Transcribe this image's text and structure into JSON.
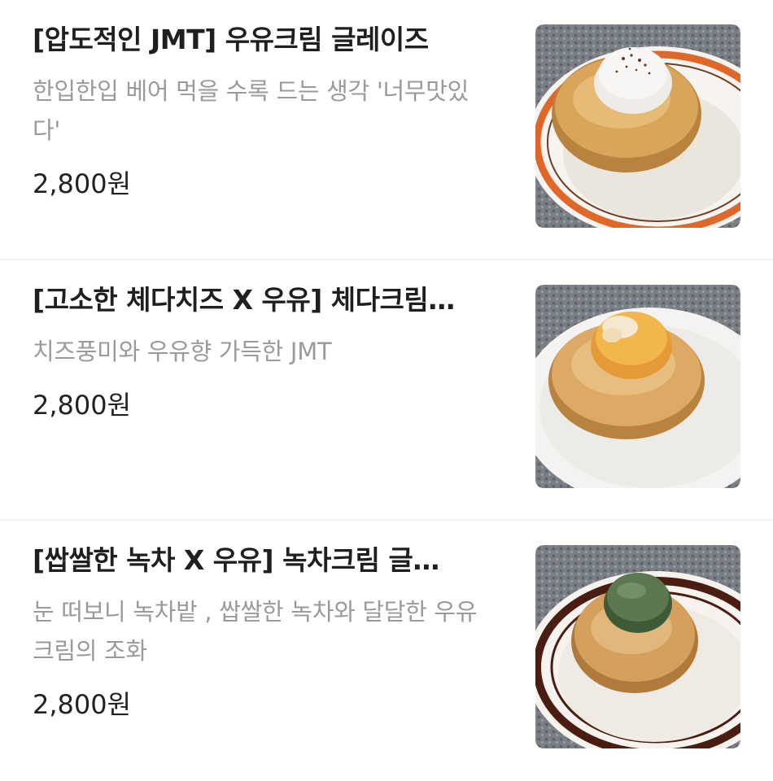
{
  "menu": {
    "items": [
      {
        "title": "[압도적인 JMT] 우유크림 글레이즈",
        "description": "한입한입 베어 먹을 수록 드는 생각 '너무맛있다'",
        "price": "2,800원",
        "image": {
          "plate_rim_color": "#e0672a",
          "cream_color": "#f2f0ee",
          "topping": "cocoa-powder"
        }
      },
      {
        "title": "[고소한 체다치즈 X 우유] 체다크림…",
        "description": "치즈풍미와 우유향 가득한 JMT",
        "price": "2,800원",
        "image": {
          "plate_rim_color": "#f4f3f1",
          "cream_color": "#f0b54a",
          "topping": "cheddar-cream"
        }
      },
      {
        "title": "[쌉쌀한 녹차 X 우유] 녹차크림 글…",
        "description": "눈 떠보니 녹차밭 , 쌉쌀한 녹차와 달달한 우유크림의 조화",
        "price": "2,800원",
        "image": {
          "plate_rim_color": "#4a1d12",
          "cream_color": "#56704a",
          "topping": "green-tea-powder"
        }
      }
    ]
  }
}
